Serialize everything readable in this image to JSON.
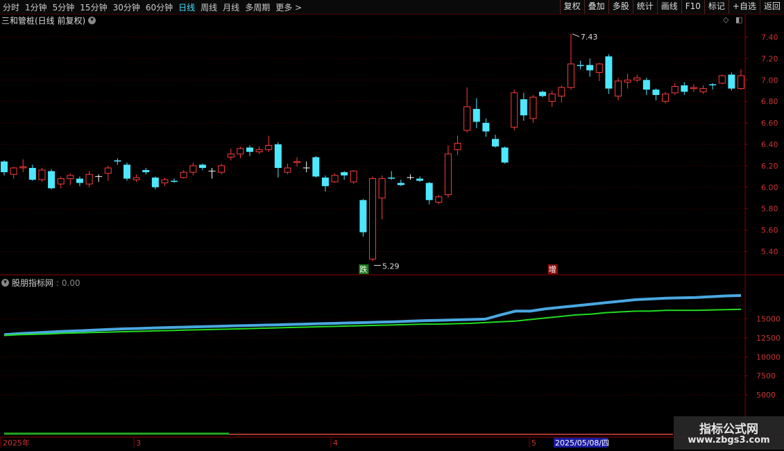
{
  "toolbar": {
    "periods": [
      "分时",
      "1分钟",
      "5分钟",
      "15分钟",
      "30分钟",
      "60分钟",
      "日线",
      "周线",
      "月线",
      "多周期",
      "更多 >"
    ],
    "active_period": "日线",
    "actions": [
      "复权",
      "叠加",
      "多股",
      "统计",
      "画线",
      "F10",
      "标记",
      "+自选",
      "返回"
    ]
  },
  "title": "三和管桩(日线 前复权)",
  "indicator": {
    "name": "股朋指标网",
    "value": ": 0.00"
  },
  "brand": {
    "line1": "指标公式网",
    "line2": "www.zbgs3.com"
  },
  "chart_data": [
    {
      "type": "candlestick",
      "price_axis": {
        "min": 5.3,
        "max": 7.5,
        "ticks": [
          "7.40",
          "7.20",
          "7.00",
          "6.80",
          "6.60",
          "6.40",
          "6.20",
          "6.00",
          "5.80",
          "5.60",
          "5.40"
        ]
      },
      "annotations": {
        "high": "7.43",
        "low": "5.29",
        "marker_down": "跌",
        "marker_up": "增"
      },
      "colors": {
        "up": "#ff3c3c",
        "down": "#4de8ff",
        "doji": "#ffffff"
      },
      "candles": [
        [
          6.24,
          6.14,
          6.25,
          6.11
        ],
        [
          6.12,
          6.18,
          6.19,
          6.08
        ],
        [
          6.18,
          6.19,
          6.26,
          6.14
        ],
        [
          6.18,
          6.07,
          6.21,
          6.06
        ],
        [
          6.07,
          6.16,
          6.18,
          6.05
        ],
        [
          6.15,
          5.99,
          6.17,
          5.98
        ],
        [
          6.03,
          6.08,
          6.1,
          5.99
        ],
        [
          6.08,
          6.11,
          6.13,
          6.02
        ],
        [
          6.08,
          6.04,
          6.1,
          6.01
        ],
        [
          6.03,
          6.12,
          6.15,
          6.0
        ],
        [
          6.1,
          6.1,
          6.12,
          6.05
        ],
        [
          6.13,
          6.18,
          6.2,
          6.06
        ],
        [
          6.25,
          6.24,
          6.27,
          6.21
        ],
        [
          6.21,
          6.08,
          6.23,
          6.06
        ],
        [
          6.07,
          6.09,
          6.12,
          6.05
        ],
        [
          6.16,
          6.14,
          6.18,
          6.12
        ],
        [
          6.09,
          6.0,
          6.1,
          5.98
        ],
        [
          6.04,
          6.07,
          6.09,
          6.01
        ],
        [
          6.06,
          6.05,
          6.08,
          6.04
        ],
        [
          6.09,
          6.14,
          6.16,
          6.08
        ],
        [
          6.14,
          6.2,
          6.23,
          6.11
        ],
        [
          6.21,
          6.18,
          6.22,
          6.16
        ],
        [
          6.15,
          6.15,
          6.18,
          6.08
        ],
        [
          6.14,
          6.2,
          6.22,
          6.12
        ],
        [
          6.28,
          6.31,
          6.36,
          6.25
        ],
        [
          6.31,
          6.36,
          6.38,
          6.27
        ],
        [
          6.37,
          6.33,
          6.39,
          6.29
        ],
        [
          6.33,
          6.35,
          6.38,
          6.31
        ],
        [
          6.35,
          6.39,
          6.48,
          6.33
        ],
        [
          6.4,
          6.18,
          6.42,
          6.09
        ],
        [
          6.14,
          6.18,
          6.22,
          6.12
        ],
        [
          6.23,
          6.24,
          6.28,
          6.19
        ],
        [
          6.18,
          6.18,
          6.24,
          6.14
        ],
        [
          6.28,
          6.1,
          6.29,
          6.09
        ],
        [
          6.09,
          6.01,
          6.11,
          5.96
        ],
        [
          6.05,
          6.11,
          6.13,
          6.04
        ],
        [
          6.14,
          6.11,
          6.15,
          6.07
        ],
        [
          6.05,
          6.15,
          6.16,
          6.03
        ],
        [
          5.88,
          5.58,
          5.89,
          5.54
        ],
        [
          5.33,
          6.08,
          6.1,
          5.31
        ],
        [
          5.9,
          6.08,
          6.11,
          5.7
        ],
        [
          6.09,
          6.08,
          6.15,
          6.07
        ],
        [
          6.04,
          6.02,
          6.07,
          6.01
        ],
        [
          6.09,
          6.09,
          6.12,
          6.07
        ],
        [
          6.08,
          6.06,
          6.1,
          6.05
        ],
        [
          6.04,
          5.88,
          6.05,
          5.84
        ],
        [
          5.86,
          5.91,
          5.93,
          5.84
        ],
        [
          5.93,
          6.31,
          6.39,
          5.9
        ],
        [
          6.35,
          6.41,
          6.48,
          6.3
        ],
        [
          6.53,
          6.75,
          6.93,
          6.51
        ],
        [
          6.73,
          6.61,
          6.83,
          6.55
        ],
        [
          6.6,
          6.52,
          6.64,
          6.47
        ],
        [
          6.45,
          6.38,
          6.49,
          6.37
        ],
        [
          6.37,
          6.23,
          6.38,
          6.22
        ],
        [
          6.56,
          6.88,
          6.91,
          6.53
        ],
        [
          6.82,
          6.67,
          6.88,
          6.62
        ],
        [
          6.64,
          6.84,
          6.86,
          6.6
        ],
        [
          6.89,
          6.85,
          6.9,
          6.84
        ],
        [
          6.8,
          6.87,
          6.9,
          6.75
        ],
        [
          6.85,
          6.93,
          6.95,
          6.79
        ],
        [
          6.93,
          7.15,
          7.43,
          6.91
        ],
        [
          7.14,
          7.13,
          7.18,
          7.1
        ],
        [
          7.14,
          7.09,
          7.2,
          7.03
        ],
        [
          7.07,
          7.15,
          7.16,
          6.99
        ],
        [
          7.22,
          6.92,
          7.24,
          6.87
        ],
        [
          6.85,
          6.99,
          7.02,
          6.81
        ],
        [
          6.98,
          7.0,
          7.06,
          6.92
        ],
        [
          7.0,
          7.02,
          7.05,
          6.98
        ],
        [
          7.0,
          6.91,
          7.02,
          6.86
        ],
        [
          6.91,
          6.86,
          6.92,
          6.81
        ],
        [
          6.8,
          6.87,
          6.89,
          6.78
        ],
        [
          6.88,
          6.94,
          6.97,
          6.86
        ],
        [
          6.95,
          6.89,
          6.98,
          6.86
        ],
        [
          6.92,
          6.93,
          6.96,
          6.89
        ],
        [
          6.89,
          6.92,
          6.95,
          6.87
        ],
        [
          6.96,
          6.95,
          6.97,
          6.91
        ],
        [
          6.97,
          7.04,
          7.05,
          6.96
        ],
        [
          7.05,
          6.92,
          7.07,
          6.9
        ],
        [
          6.92,
          7.04,
          7.1,
          6.91
        ]
      ]
    },
    {
      "type": "line",
      "y_axis": {
        "min": 0,
        "max": 19500,
        "ticks": [
          "15000",
          "12500",
          "10000",
          "7500",
          "5000"
        ]
      },
      "x_labels": [
        "2025年",
        "3",
        "4",
        "5",
        "2025/05/08/四"
      ],
      "series": [
        {
          "color": "#4aa8e0",
          "values": [
            12900,
            13050,
            13150,
            13250,
            13350,
            13420,
            13500,
            13600,
            13680,
            13720,
            13800,
            13850,
            13900,
            13950,
            14000,
            14050,
            14100,
            14150,
            14200,
            14250,
            14300,
            14350,
            14400,
            14450,
            14500,
            14550,
            14600,
            14680,
            14750,
            14800,
            14850,
            14900,
            14950,
            15500,
            16000,
            16000,
            16300,
            16500,
            16700,
            16900,
            17100,
            17300,
            17500,
            17600,
            17700,
            17750,
            17800,
            17900,
            18000,
            18050
          ]
        },
        {
          "color": "#22dd22",
          "values": [
            12800,
            12900,
            12950,
            13000,
            13100,
            13150,
            13200,
            13250,
            13300,
            13350,
            13400,
            13450,
            13500,
            13550,
            13600,
            13650,
            13700,
            13750,
            13800,
            13850,
            13900,
            13950,
            14000,
            14050,
            14100,
            14150,
            14200,
            14250,
            14300,
            14300,
            14350,
            14400,
            14500,
            14600,
            14700,
            14900,
            15100,
            15300,
            15500,
            15600,
            15800,
            15900,
            16000,
            16000,
            16100,
            16100,
            16100,
            16150,
            16200,
            16250
          ]
        }
      ]
    }
  ]
}
